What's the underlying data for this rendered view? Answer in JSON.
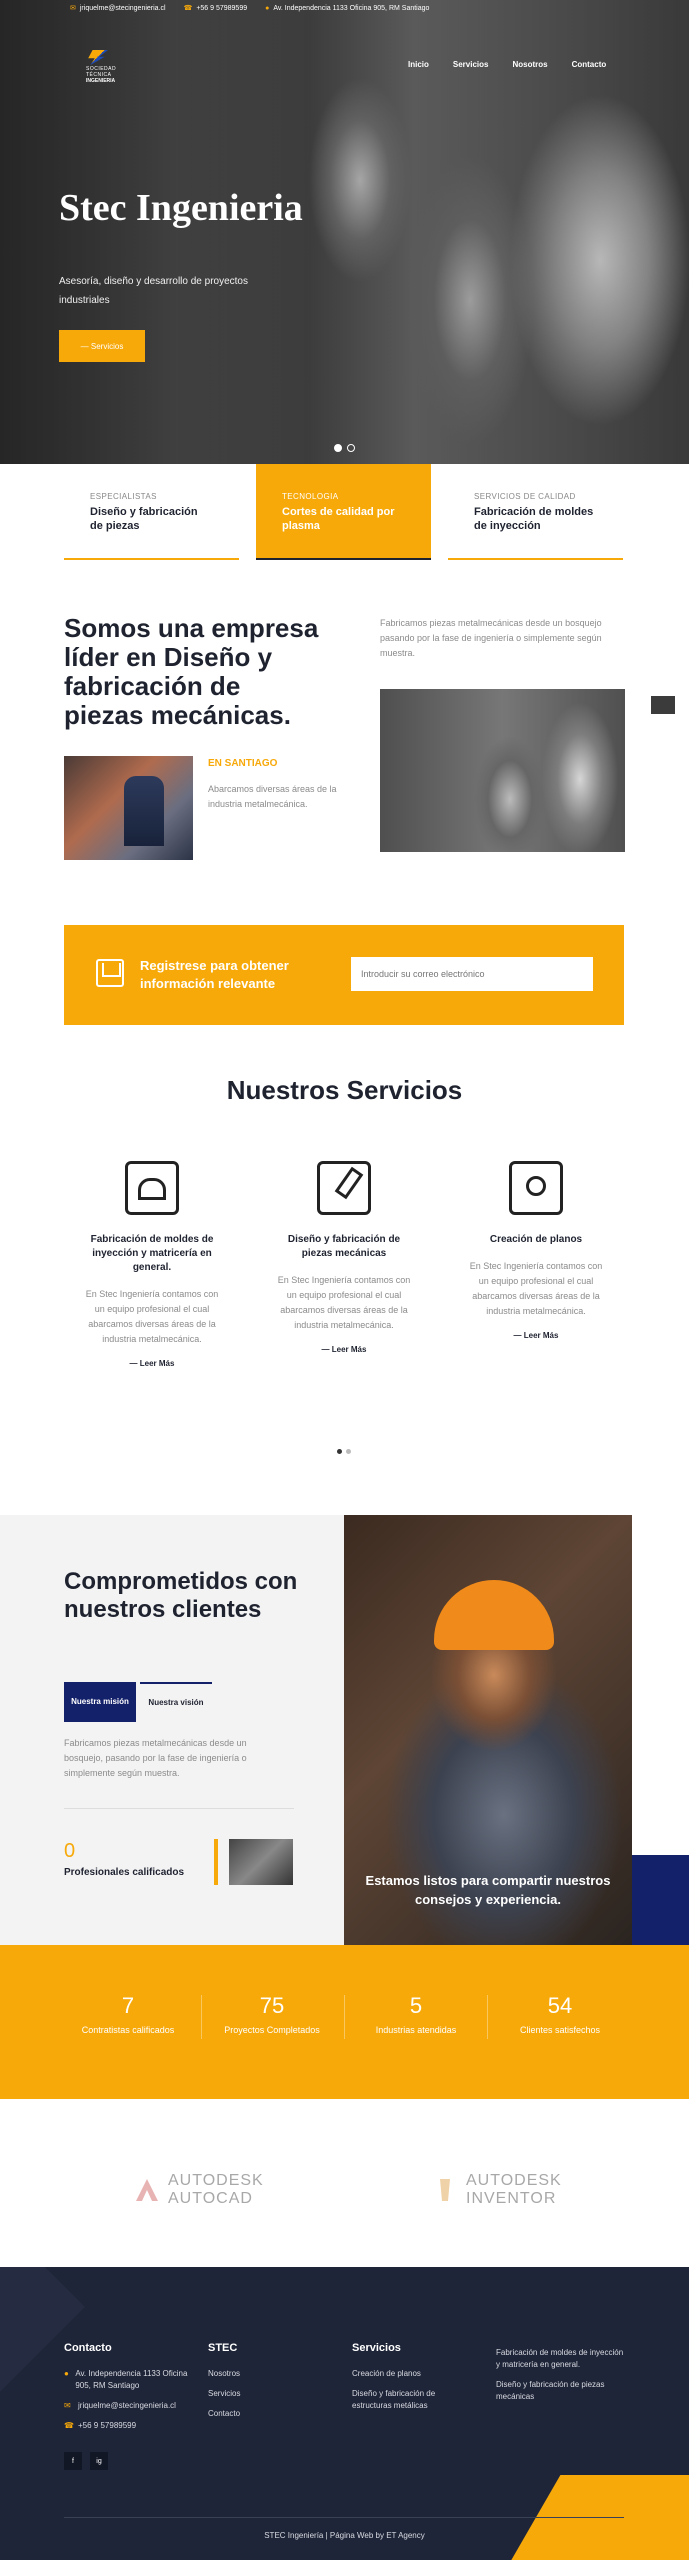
{
  "topbar": {
    "email": "jriquelme@stecingenieria.cl",
    "phone": "+56 9 57989599",
    "address": "Av. Independencia 1133 Oficina 905, RM Santiago"
  },
  "brand": {
    "line1": "SOCIEDAD TÉCNICA",
    "line2": "INGENIERIA"
  },
  "nav": [
    "Inicio",
    "Servicios",
    "Nosotros",
    "Contacto"
  ],
  "hero": {
    "title": "Stec Ingenieria",
    "subtitle": "Asesoría, diseño y desarrollo de proyectos industriales",
    "cta": "— Servicios",
    "slides": 2,
    "active_slide": 1
  },
  "tabs": [
    {
      "kicker": "ESPECIALISTAS",
      "title": "Diseño y fabricación de piezas"
    },
    {
      "kicker": "TECNOLOGIA",
      "title": "Cortes de calidad por plasma"
    },
    {
      "kicker": "SERVICIOS DE CALIDAD",
      "title": "Fabricación de moldes de inyección"
    }
  ],
  "about": {
    "title": "Somos una empresa líder en Diseño y fabricación de piezas mecánicas.",
    "text": "Fabricamos piezas metalmecánicas desde un bosquejo pasando por la fase de ingeniería o simplemente según muestra.",
    "kicker": "EN SANTIAGO",
    "small": "Abarcamos diversas áreas de la industria metalmecánica."
  },
  "subscribe": {
    "text": "Registrese para obtener información relevante",
    "placeholder": "Introducir su correo electrónico"
  },
  "services": {
    "title": "Nuestros Servicios",
    "cards": [
      {
        "title": "Fabricación de moldes de inyección y matricería en general.",
        "text": "En Stec Ingeniería contamos con un equipo profesional el cual abarcamos diversas áreas de la industria metalmecánica.",
        "more": "Leer Más"
      },
      {
        "title": "Diseño y fabricación de piezas mecánicas",
        "text": "En Stec Ingeniería contamos con un equipo profesional el cual abarcamos diversas áreas de la industria metalmecánica.",
        "more": "Leer Más"
      },
      {
        "title": "Creación de planos",
        "text": "En Stec Ingeniería contamos con un equipo profesional el cual abarcamos diversas áreas de la industria metalmecánica.",
        "more": "Leer Más"
      }
    ]
  },
  "commitment": {
    "title": "Comprometidos con nuestros clientes",
    "tab_mission": "Nuestra misión",
    "tab_vision": "Nuestra visión",
    "text": "Fabricamos piezas metalmecánicas desde un bosquejo, pasando por la fase de ingeniería o simplemente según muestra.",
    "count": "0",
    "count_label": "Profesionales calificados",
    "caption": "Estamos listos para compartir nuestros consejos y experiencia."
  },
  "stats": [
    {
      "n": "7",
      "l": "Contratistas calificados"
    },
    {
      "n": "75",
      "l": "Proyectos Completados"
    },
    {
      "n": "5",
      "l": "Industrias atendidas"
    },
    {
      "n": "54",
      "l": "Clientes satisfechos"
    }
  ],
  "logos": [
    {
      "l1": "AUTODESK",
      "l2": "AUTOCAD"
    },
    {
      "l1": "AUTODESK",
      "l2": "INVENTOR"
    }
  ],
  "footer": {
    "contact_title": "Contacto",
    "address": "Av. Independencia 1133 Oficina 905, RM Santiago",
    "email": "jriquelme@stecingenieria.cl",
    "phone": "+56 9 57989599",
    "stec_title": "STEC",
    "stec_links": [
      "Nosotros",
      "Servicios",
      "Contacto"
    ],
    "services_title": "Servicios",
    "services_links": [
      "Creación de planos",
      "Diseño y fabricación de estructuras metálicas"
    ],
    "extra_links": [
      "Fabricación de moldes de inyección y matricería en general.",
      "Diseño y fabricación de piezas mecánicas"
    ],
    "social": [
      "f",
      "ig"
    ],
    "copyright": "STEC Ingeniería | Página Web by ET Agency"
  },
  "colors": {
    "accent": "#f7a90a",
    "navy": "#13206a",
    "dark": "#1f2538"
  }
}
